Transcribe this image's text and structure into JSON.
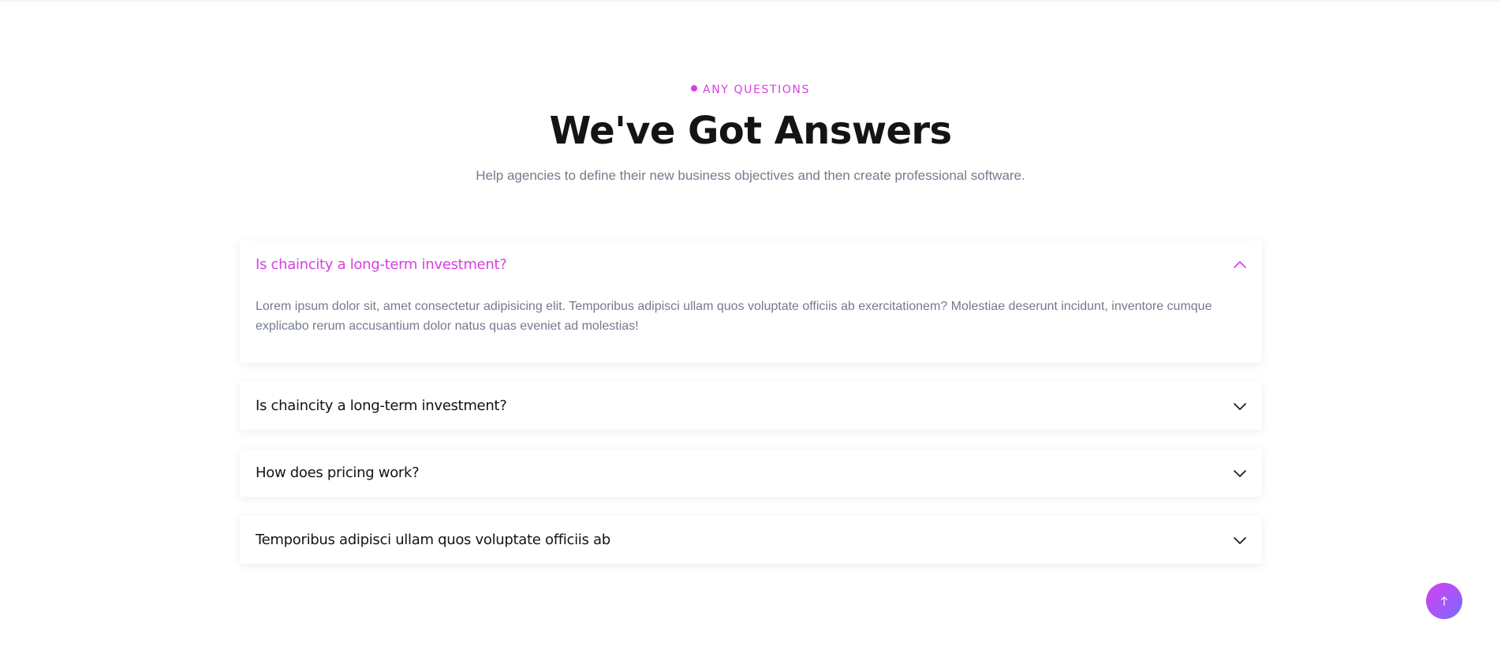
{
  "section": {
    "eyebrow": "ANY QUESTIONS",
    "title": "We've Got Answers",
    "subtitle": "Help agencies to define their new business objectives and then create professional software."
  },
  "faq": {
    "items": [
      {
        "question": "Is chaincity a long-term investment?",
        "answer": "Lorem ipsum dolor sit, amet consectetur adipisicing elit. Temporibus adipisci ullam quos voluptate officiis ab exercitationem? Molestiae deserunt incidunt, inventore cumque explicabo rerum accusantium dolor natus quas eveniet ad molestias!",
        "expanded": true,
        "icon": "chevron-up-icon"
      },
      {
        "question": "Is chaincity a long-term investment?",
        "expanded": false,
        "icon": "chevron-down-icon"
      },
      {
        "question": "How does pricing work?",
        "expanded": false,
        "icon": "chevron-down-icon"
      },
      {
        "question": "Temporibus adipisci ullam quos voluptate officiis ab",
        "expanded": false,
        "icon": "chevron-down-icon"
      }
    ]
  },
  "scroll_top": {
    "icon": "arrow-up-icon"
  },
  "colors": {
    "accent": "#d93de4",
    "heading": "#141414",
    "muted_text": "#737b8c",
    "scroll_gradient_start": "#d63ff0",
    "scroll_gradient_end": "#7a6bff"
  }
}
